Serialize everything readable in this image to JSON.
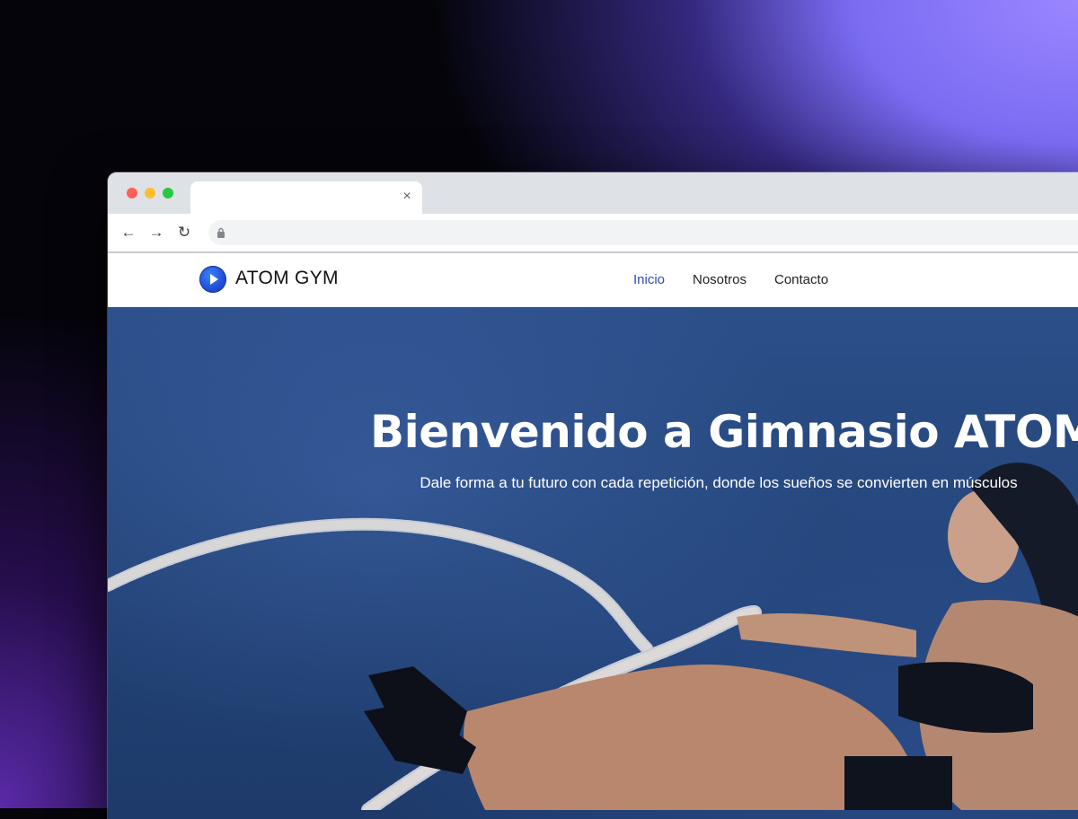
{
  "browser": {
    "tab_close_glyph": "×",
    "nav": {
      "back_glyph": "←",
      "forward_glyph": "→",
      "reload_glyph": "↻"
    }
  },
  "site": {
    "brand": {
      "name": "ATOM GYM",
      "logo_icon": "play-icon"
    },
    "nav_links": [
      {
        "label": "Inicio",
        "active": true
      },
      {
        "label": "Nosotros",
        "active": false
      },
      {
        "label": "Contacto",
        "active": false
      }
    ],
    "hero": {
      "title": "Bienvenido a Gimnasio ATOM",
      "subtitle": "Dale forma a tu futuro con cada repetición, donde los sueños se convierten en músculos"
    }
  },
  "colors": {
    "accent": "#2b4ea8",
    "hero_bg": "#234477",
    "brand_logo": "#1d4ed8"
  }
}
